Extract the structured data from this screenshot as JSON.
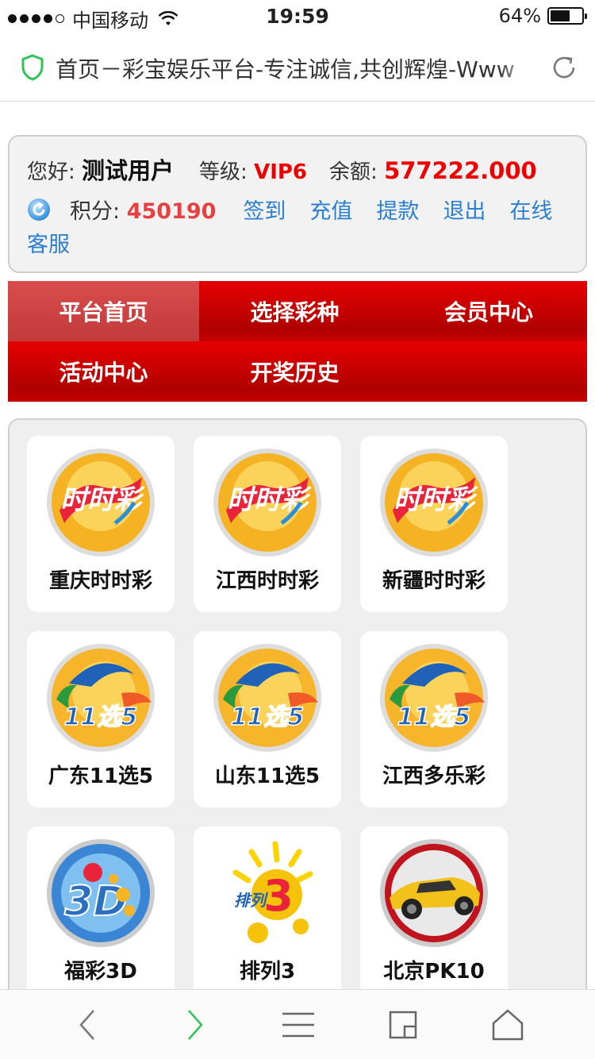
{
  "status": {
    "carrier": "中国移动",
    "time": "19:59",
    "battery": "64%",
    "battery_level": 0.64
  },
  "browser": {
    "page_title": "首页－彩宝娱乐平台-专注诚信,共创辉煌-Www"
  },
  "user": {
    "greeting_label": "您好:",
    "username": "测试用户",
    "level_label": "等级:",
    "level": "VIP6",
    "balance_label": "余额:",
    "balance": "577222.000",
    "points_label": "积分:",
    "points": "450190",
    "links": {
      "signin": "签到",
      "deposit": "充值",
      "withdraw": "提款",
      "logout": "退出",
      "support": "在线客服"
    }
  },
  "nav": [
    "平台首页",
    "选择彩种",
    "会员中心",
    "活动中心",
    "开奖历史"
  ],
  "games": [
    {
      "name": "重庆时时彩",
      "icon": "ssc-lottery-icon"
    },
    {
      "name": "江西时时彩",
      "icon": "ssc-lottery-icon"
    },
    {
      "name": "新疆时时彩",
      "icon": "ssc-lottery-icon"
    },
    {
      "name": "广东11选5",
      "icon": "11x5-lottery-icon"
    },
    {
      "name": "山东11选5",
      "icon": "11x5-lottery-icon"
    },
    {
      "name": "江西多乐彩",
      "icon": "11x5-lottery-icon"
    },
    {
      "name": "福彩3D",
      "icon": "fc3d-lottery-icon"
    },
    {
      "name": "排列3",
      "icon": "pl3-lottery-icon"
    },
    {
      "name": "北京PK10",
      "icon": "pk10-car-icon"
    }
  ],
  "colors": {
    "primary_red": "#e60000",
    "link_blue": "#2a7fd0",
    "value_red": "#e00000"
  }
}
